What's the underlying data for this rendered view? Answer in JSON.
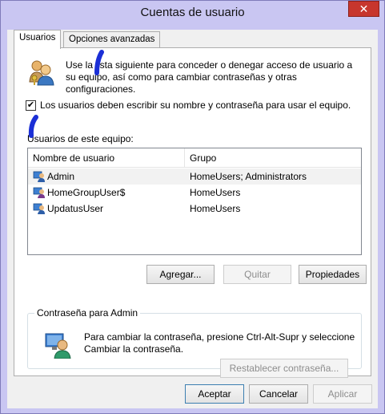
{
  "window": {
    "title": "Cuentas de usuario",
    "close_symbol": "✕"
  },
  "tabs": [
    {
      "label": "Usuarios",
      "active": true
    },
    {
      "label": "Opciones avanzadas",
      "active": false
    }
  ],
  "description": "Use la lista siguiente para conceder o denegar acceso de usuario a su equipo, así como para cambiar contraseñas y otras configuraciones.",
  "require_login": {
    "checked": true,
    "check_symbol": "✔",
    "label": "Los usuarios deben escribir su nombre y contraseña para usar el equipo."
  },
  "users_list": {
    "label": "Usuarios de este equipo:",
    "columns": [
      "Nombre de usuario",
      "Grupo"
    ],
    "rows": [
      {
        "name": "Admin",
        "group": "HomeUsers; Administrators",
        "selected": true
      },
      {
        "name": "HomeGroupUser$",
        "group": "HomeUsers",
        "selected": false
      },
      {
        "name": "UpdatusUser",
        "group": "HomeUsers",
        "selected": false
      }
    ]
  },
  "actions": {
    "add": "Agregar...",
    "remove": "Quitar",
    "properties": "Propiedades"
  },
  "password_group": {
    "title": "Contraseña para Admin",
    "text": "Para cambiar la contraseña, presione Ctrl-Alt-Supr y seleccione Cambiar la contraseña.",
    "reset_button": "Restablecer contraseña..."
  },
  "dialog_buttons": {
    "ok": "Aceptar",
    "cancel": "Cancelar",
    "apply": "Aplicar"
  }
}
